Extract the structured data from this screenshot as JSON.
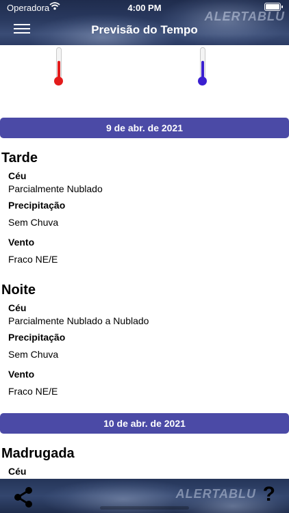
{
  "status_bar": {
    "carrier": "Operadora",
    "time": "4:00 PM"
  },
  "header": {
    "title": "Previsão do Tempo",
    "logo": "ALERTABLU"
  },
  "thermometers": [
    {
      "icon": "thermometer-hot-icon",
      "color": "#e31b1b"
    },
    {
      "icon": "thermometer-cold-icon",
      "color": "#3a1fd0"
    }
  ],
  "days": [
    {
      "date": "9 de abr. de 2021",
      "periods": [
        {
          "name": "Tarde",
          "ceu_label": "Céu",
          "ceu": "Parcialmente Nublado",
          "precip_label": "Precipitação",
          "precip": "Sem Chuva",
          "vento_label": "Vento",
          "vento": "Fraco NE/E"
        },
        {
          "name": "Noite",
          "ceu_label": "Céu",
          "ceu": "Parcialmente Nublado a Nublado",
          "precip_label": "Precipitação",
          "precip": "Sem Chuva",
          "vento_label": "Vento",
          "vento": "Fraco NE/E"
        }
      ]
    },
    {
      "date": "10 de abr. de 2021",
      "periods": [
        {
          "name": "Madrugada",
          "ceu_label": "Céu"
        }
      ]
    }
  ],
  "footer": {
    "logo": "ALERTABLU",
    "help": "?"
  },
  "colors": {
    "date_bar": "#4b4aa6",
    "header": "#2a3a60"
  }
}
